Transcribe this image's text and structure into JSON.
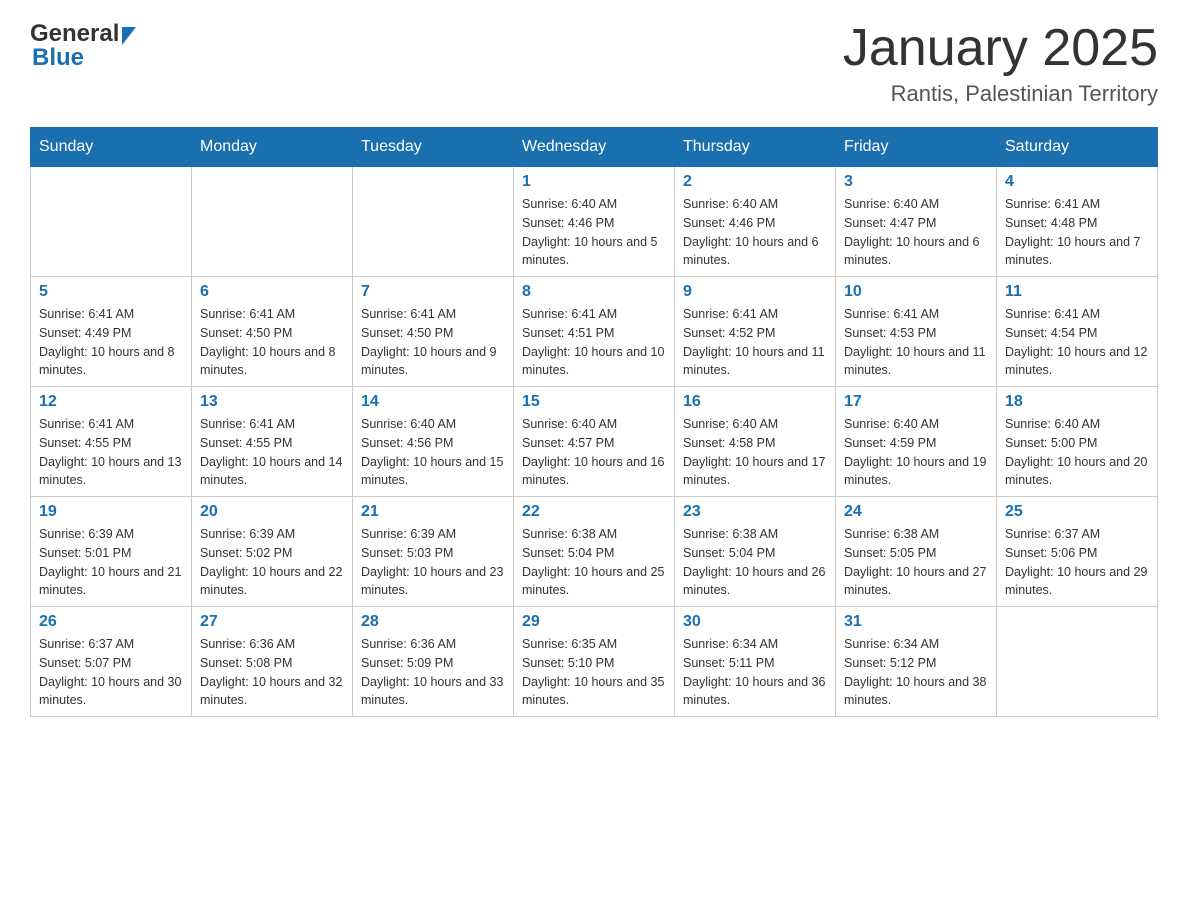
{
  "header": {
    "title": "January 2025",
    "location": "Rantis, Palestinian Territory"
  },
  "logo": {
    "general": "General",
    "blue": "Blue"
  },
  "days_of_week": [
    "Sunday",
    "Monday",
    "Tuesday",
    "Wednesday",
    "Thursday",
    "Friday",
    "Saturday"
  ],
  "weeks": [
    [
      {
        "day": "",
        "info": ""
      },
      {
        "day": "",
        "info": ""
      },
      {
        "day": "",
        "info": ""
      },
      {
        "day": "1",
        "info": "Sunrise: 6:40 AM\nSunset: 4:46 PM\nDaylight: 10 hours and 5 minutes."
      },
      {
        "day": "2",
        "info": "Sunrise: 6:40 AM\nSunset: 4:46 PM\nDaylight: 10 hours and 6 minutes."
      },
      {
        "day": "3",
        "info": "Sunrise: 6:40 AM\nSunset: 4:47 PM\nDaylight: 10 hours and 6 minutes."
      },
      {
        "day": "4",
        "info": "Sunrise: 6:41 AM\nSunset: 4:48 PM\nDaylight: 10 hours and 7 minutes."
      }
    ],
    [
      {
        "day": "5",
        "info": "Sunrise: 6:41 AM\nSunset: 4:49 PM\nDaylight: 10 hours and 8 minutes."
      },
      {
        "day": "6",
        "info": "Sunrise: 6:41 AM\nSunset: 4:50 PM\nDaylight: 10 hours and 8 minutes."
      },
      {
        "day": "7",
        "info": "Sunrise: 6:41 AM\nSunset: 4:50 PM\nDaylight: 10 hours and 9 minutes."
      },
      {
        "day": "8",
        "info": "Sunrise: 6:41 AM\nSunset: 4:51 PM\nDaylight: 10 hours and 10 minutes."
      },
      {
        "day": "9",
        "info": "Sunrise: 6:41 AM\nSunset: 4:52 PM\nDaylight: 10 hours and 11 minutes."
      },
      {
        "day": "10",
        "info": "Sunrise: 6:41 AM\nSunset: 4:53 PM\nDaylight: 10 hours and 11 minutes."
      },
      {
        "day": "11",
        "info": "Sunrise: 6:41 AM\nSunset: 4:54 PM\nDaylight: 10 hours and 12 minutes."
      }
    ],
    [
      {
        "day": "12",
        "info": "Sunrise: 6:41 AM\nSunset: 4:55 PM\nDaylight: 10 hours and 13 minutes."
      },
      {
        "day": "13",
        "info": "Sunrise: 6:41 AM\nSunset: 4:55 PM\nDaylight: 10 hours and 14 minutes."
      },
      {
        "day": "14",
        "info": "Sunrise: 6:40 AM\nSunset: 4:56 PM\nDaylight: 10 hours and 15 minutes."
      },
      {
        "day": "15",
        "info": "Sunrise: 6:40 AM\nSunset: 4:57 PM\nDaylight: 10 hours and 16 minutes."
      },
      {
        "day": "16",
        "info": "Sunrise: 6:40 AM\nSunset: 4:58 PM\nDaylight: 10 hours and 17 minutes."
      },
      {
        "day": "17",
        "info": "Sunrise: 6:40 AM\nSunset: 4:59 PM\nDaylight: 10 hours and 19 minutes."
      },
      {
        "day": "18",
        "info": "Sunrise: 6:40 AM\nSunset: 5:00 PM\nDaylight: 10 hours and 20 minutes."
      }
    ],
    [
      {
        "day": "19",
        "info": "Sunrise: 6:39 AM\nSunset: 5:01 PM\nDaylight: 10 hours and 21 minutes."
      },
      {
        "day": "20",
        "info": "Sunrise: 6:39 AM\nSunset: 5:02 PM\nDaylight: 10 hours and 22 minutes."
      },
      {
        "day": "21",
        "info": "Sunrise: 6:39 AM\nSunset: 5:03 PM\nDaylight: 10 hours and 23 minutes."
      },
      {
        "day": "22",
        "info": "Sunrise: 6:38 AM\nSunset: 5:04 PM\nDaylight: 10 hours and 25 minutes."
      },
      {
        "day": "23",
        "info": "Sunrise: 6:38 AM\nSunset: 5:04 PM\nDaylight: 10 hours and 26 minutes."
      },
      {
        "day": "24",
        "info": "Sunrise: 6:38 AM\nSunset: 5:05 PM\nDaylight: 10 hours and 27 minutes."
      },
      {
        "day": "25",
        "info": "Sunrise: 6:37 AM\nSunset: 5:06 PM\nDaylight: 10 hours and 29 minutes."
      }
    ],
    [
      {
        "day": "26",
        "info": "Sunrise: 6:37 AM\nSunset: 5:07 PM\nDaylight: 10 hours and 30 minutes."
      },
      {
        "day": "27",
        "info": "Sunrise: 6:36 AM\nSunset: 5:08 PM\nDaylight: 10 hours and 32 minutes."
      },
      {
        "day": "28",
        "info": "Sunrise: 6:36 AM\nSunset: 5:09 PM\nDaylight: 10 hours and 33 minutes."
      },
      {
        "day": "29",
        "info": "Sunrise: 6:35 AM\nSunset: 5:10 PM\nDaylight: 10 hours and 35 minutes."
      },
      {
        "day": "30",
        "info": "Sunrise: 6:34 AM\nSunset: 5:11 PM\nDaylight: 10 hours and 36 minutes."
      },
      {
        "day": "31",
        "info": "Sunrise: 6:34 AM\nSunset: 5:12 PM\nDaylight: 10 hours and 38 minutes."
      },
      {
        "day": "",
        "info": ""
      }
    ]
  ]
}
